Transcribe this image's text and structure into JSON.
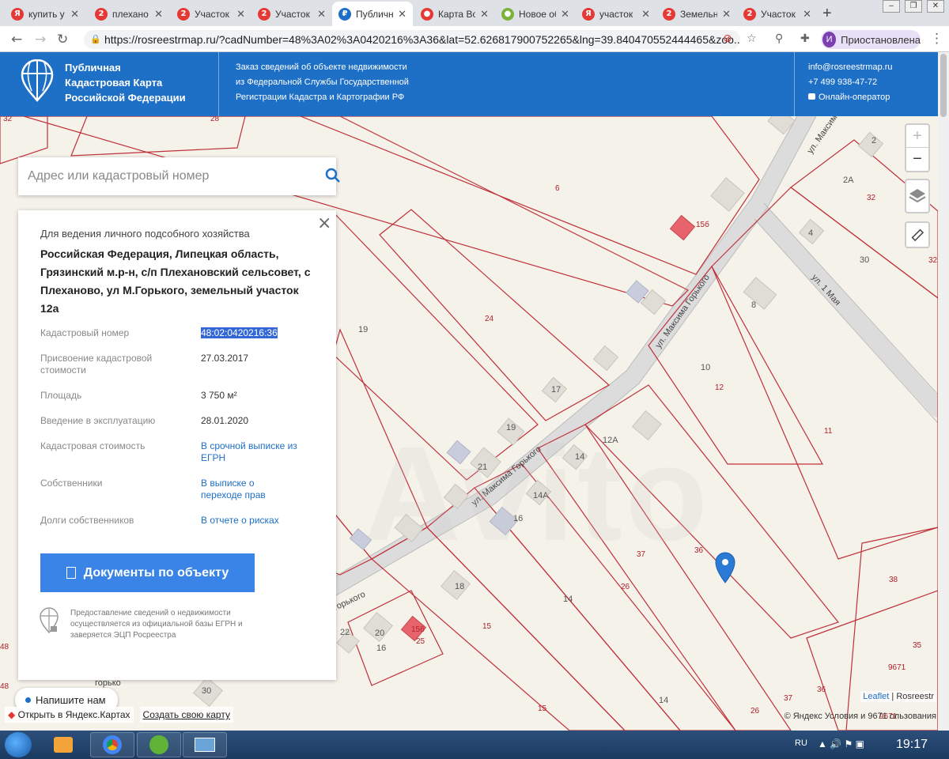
{
  "browser": {
    "tabs": [
      {
        "title": "купить у",
        "icon": "yandex-icon",
        "color": "#e53935",
        "glyph": "Я"
      },
      {
        "title": "плехано",
        "icon": "avito-2-icon",
        "color": "#e53935",
        "glyph": "2"
      },
      {
        "title": "Участок",
        "icon": "avito-2-icon",
        "color": "#e53935",
        "glyph": "2"
      },
      {
        "title": "Участок",
        "icon": "avito-2-icon",
        "color": "#e53935",
        "glyph": "2"
      },
      {
        "title": "Публичн",
        "icon": "rosreestr-icon",
        "color": "#1e6fc6",
        "glyph": "₽"
      },
      {
        "title": "Карта Во",
        "icon": "map-pin-icon",
        "color": "#e53935",
        "glyph": "●"
      },
      {
        "title": "Новое об",
        "icon": "avito-dots-icon",
        "color": "#7bb33a",
        "glyph": "●"
      },
      {
        "title": "участок",
        "icon": "yandex-icon",
        "color": "#e53935",
        "glyph": "Я"
      },
      {
        "title": "Земельн",
        "icon": "avito-2-icon",
        "color": "#e53935",
        "glyph": "2"
      },
      {
        "title": "Участок",
        "icon": "avito-2-icon",
        "color": "#e53935",
        "glyph": "2"
      }
    ],
    "url": "https://rosreestrmap.ru/?cadNumber=48%3A02%3A0420216%3A36&lat=52.626817900752265&lng=39.840470552444465&zoo...",
    "profile_initial": "И",
    "profile_label": "Приостановлена"
  },
  "header": {
    "brand_lines": [
      "Публичная",
      "Кадастровая Карта",
      "Российской Федерации"
    ],
    "info_lines": [
      "Заказ сведений об объекте недвижимости",
      "из Федеральной Службы Государственной",
      "Регистрации Кадастра и Картографии РФ"
    ],
    "email": "info@rosreestrmap.ru",
    "phone": "+7 499 938-47-72",
    "operator": "Онлайн-оператор"
  },
  "search": {
    "placeholder": "Адрес или кадастровый номер"
  },
  "panel": {
    "purpose": "Для ведения личного подсобного хозяйства",
    "address": "Российская Федерация, Липецкая область, Грязинский м.р-н, с/п Плехановский сельсовет, с Плеханово, ул М.Горького, земельный участок 12а",
    "rows": [
      {
        "label": "Кадастровый номер",
        "value": "48:02:0420216:36"
      },
      {
        "label": "Присвоение кадастровой стоимости",
        "value": "27.03.2017"
      },
      {
        "label": "Площадь",
        "value": "3 750 м²"
      },
      {
        "label": "Введение в эксплуатацию",
        "value": "28.01.2020"
      },
      {
        "label": "Кадастровая стоимость",
        "value": "В срочной выписке из ЕГРН"
      },
      {
        "label": "Собственники",
        "value": "В выписке о переходе прав"
      },
      {
        "label": "Долги собственников",
        "value": "В отчете о рисках"
      }
    ],
    "doc_button": "Документы по объекту",
    "footnote": "Предоставление сведений о недвижимости осуществляется из официальной базы ЕГРН и заверяется ЭЦП Росреестра"
  },
  "map": {
    "street_labels": [
      "ул. Максима Горького",
      "ул. Максима Горького",
      "ул. Максима",
      "ул. 1 Мая",
      "горького",
      "горько"
    ],
    "parcel_numbers": [
      "32",
      "28",
      "6",
      "2",
      "2А",
      "32",
      "4",
      "30",
      "32",
      "8",
      "24",
      "19",
      "10",
      "12",
      "17",
      "11",
      "19",
      "12А",
      "14",
      "21",
      "14А",
      "16",
      "37",
      "36",
      "38",
      "26",
      "18",
      "14",
      "15",
      "20",
      "22",
      "16",
      "25",
      "35",
      "9671",
      "36",
      "37",
      "14",
      "15",
      "26",
      "30",
      "48",
      "48",
      "9671",
      "15б",
      "15б"
    ],
    "zoom_in": "+",
    "zoom_out": "−",
    "chat_label": "Напишите нам",
    "yandex_open": "Открыть в Яндекс.Картах",
    "create_map": "Создать свою карту",
    "attribution_leaflet": "Leaflet",
    "attribution_sep": "|",
    "attribution_rosreestr": "Rosreestr",
    "attribution_yandex": "© Яндекс Условия и 9671 ользования"
  },
  "taskbar": {
    "lang": "RU",
    "time": "19:17"
  }
}
